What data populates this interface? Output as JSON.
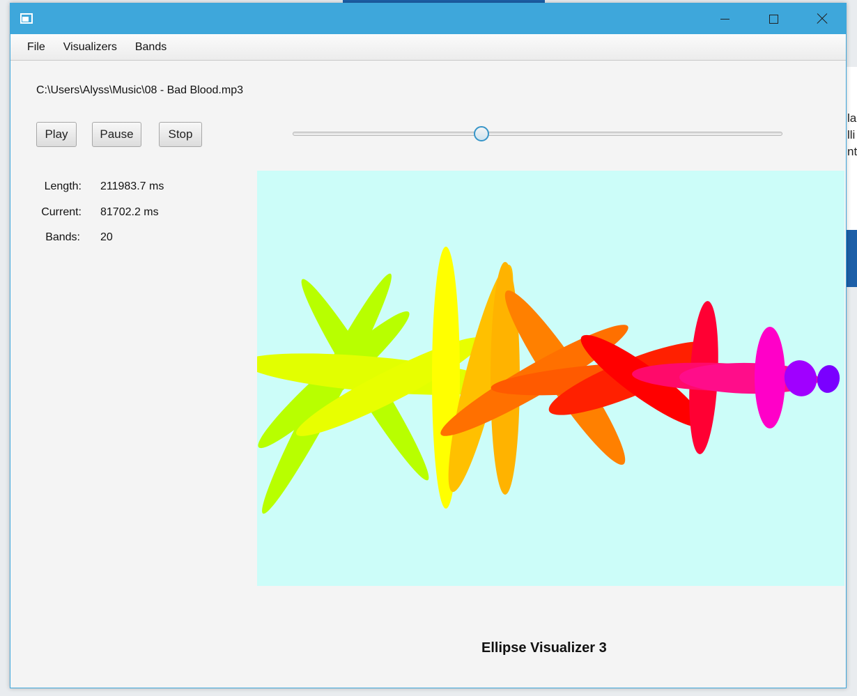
{
  "window": {
    "title": ""
  },
  "menubar": {
    "items": [
      {
        "label": "File"
      },
      {
        "label": "Visualizers"
      },
      {
        "label": "Bands"
      }
    ]
  },
  "player": {
    "file_path": "C:\\Users\\Alyss\\Music\\08 - Bad Blood.mp3",
    "play_label": "Play",
    "pause_label": "Pause",
    "stop_label": "Stop",
    "seek_position_fraction": 0.385,
    "length_label": "Length:",
    "length_value": "211983.7 ms",
    "current_label": "Current:",
    "current_value": "81702.2 ms",
    "bands_label": "Bands:",
    "bands_value": "20"
  },
  "visualizer": {
    "name": "Ellipse Visualizer 3",
    "background_color": "#ccfdf9"
  },
  "colors": {
    "titlebar": "#3ea7db",
    "accent": "#3795c8"
  },
  "background_app_text": [
    "la",
    "lli",
    "nt"
  ]
}
